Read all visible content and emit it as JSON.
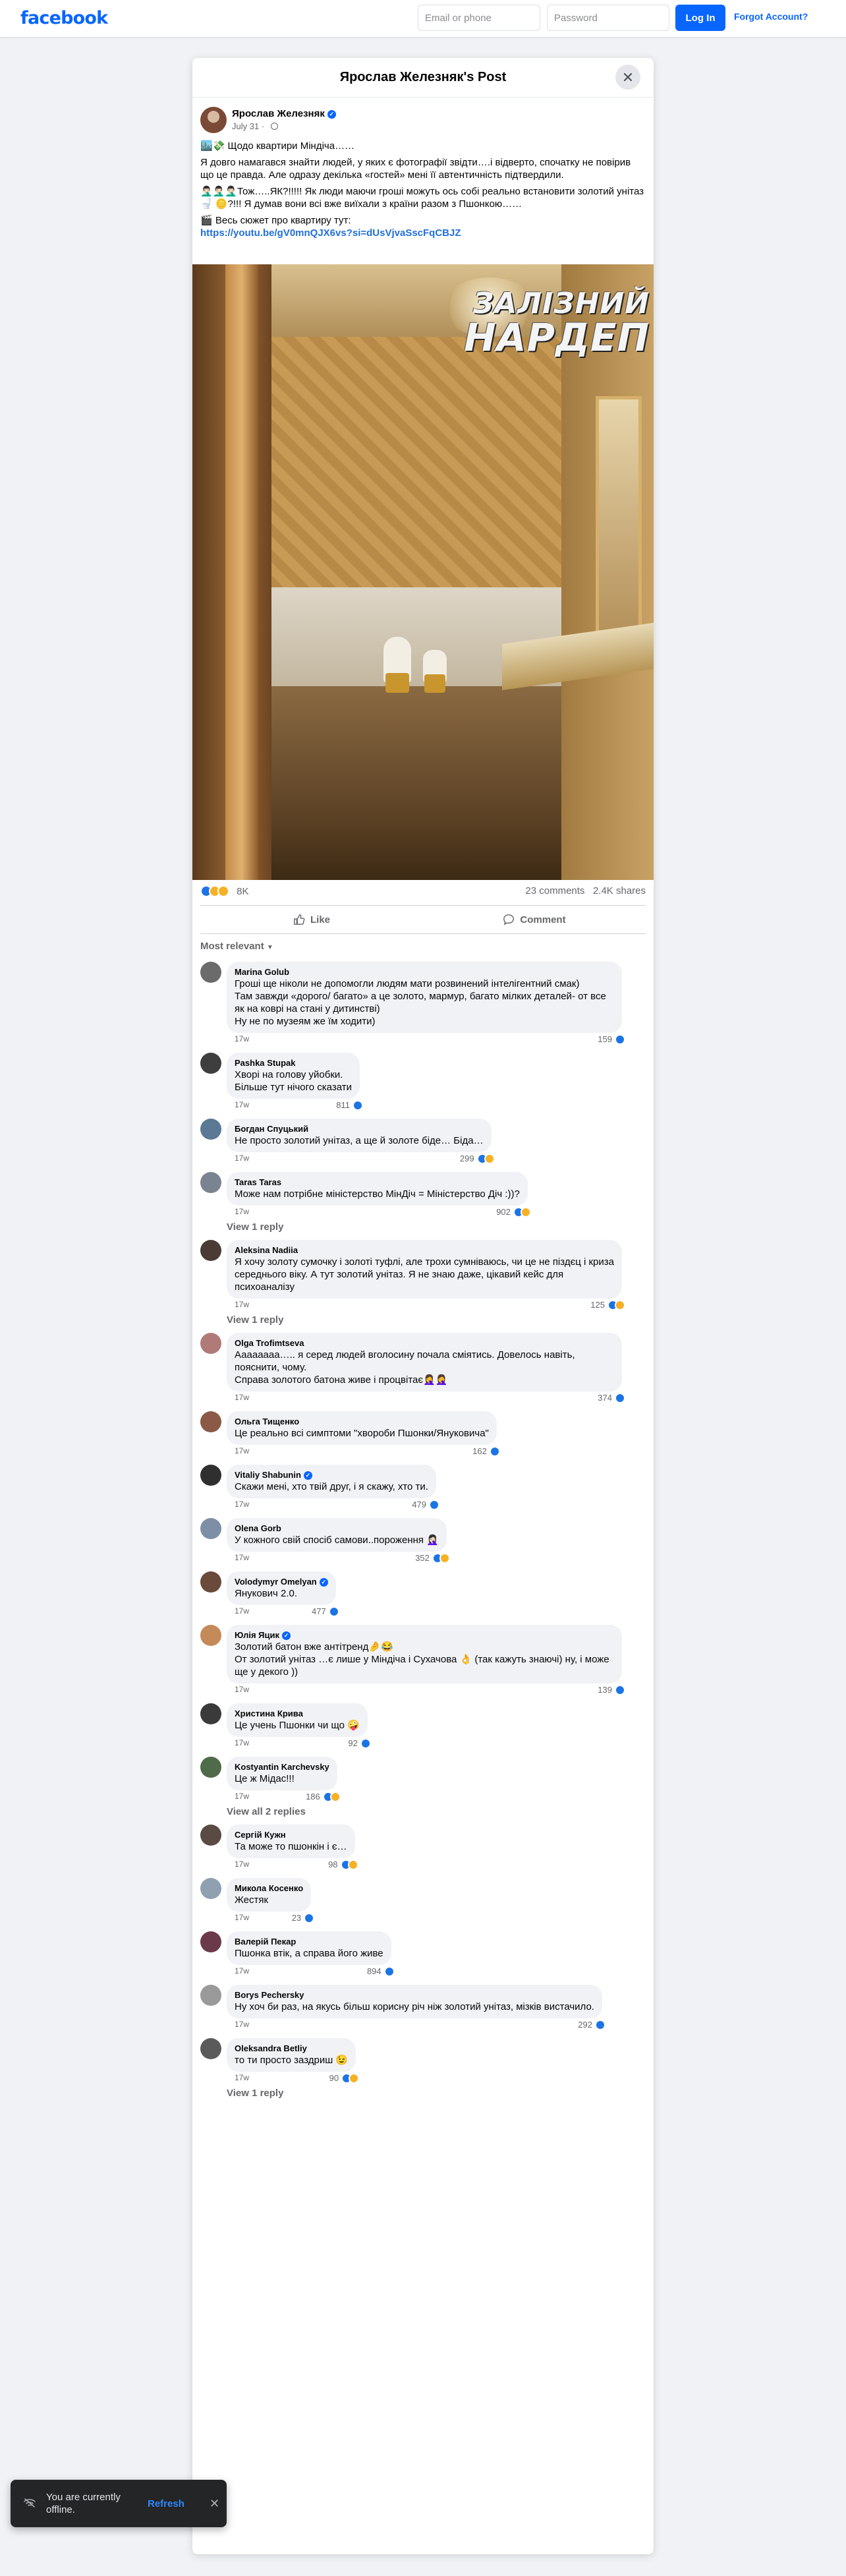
{
  "topbar": {
    "logo": "facebook",
    "email_placeholder": "Email or phone",
    "password_placeholder": "Password",
    "login_label": "Log In",
    "forgot_label": "Forgot Account?"
  },
  "post": {
    "dialog_title": "Ярослав Железняк's Post",
    "author": "Ярослав Железняк",
    "date": "July 31",
    "paragraphs": [
      "🏙️💸 Щодо квартири Міндіча……",
      "Я довго намагався знайти людей, у яких є фотографії звідти….і відверто, спочатку не повірив що це правда. Але одразу декілька «гостей» мені її автентичність підтвердили.",
      "🤦🏻‍♂️🤦🏻‍♂️🤦🏻‍♂️Тож…..ЯК?!!!!! Як люди маючи гроші можуть ось собі реально встановити золотий унітаз 🚽 🪙?!!! Я думав вони всі вже виїхали з країни разом з Пшонкою……",
      "🎬 Весь сюжет про квартиру тут:"
    ],
    "link": "https://youtu.be/gV0mnQJX6vs?si=dUsVjvaSscFqCBJZ",
    "video_logo_line1": "ЗАЛІЗНИЙ",
    "video_logo_line2": "НАРДЕП",
    "reaction_count": "8K",
    "comments_count": "23 comments",
    "shares_count": "2.4K shares",
    "like_label": "Like",
    "comment_label": "Comment",
    "sort_label": "Most relevant"
  },
  "comments": [
    {
      "name": "Marina Golub",
      "verified": false,
      "text": "Гроші ще ніколи не допомогли людям мати розвинений інтелігентний смак)\nТам завжди «дорого/ багато» а це золото, мармур, багато мілких деталей- от все як на коврі на стані у дитинстві)\nНу не по музеям же їм ходити)",
      "time": "17w",
      "reactions": "159",
      "icons": [
        "like"
      ],
      "replies": "",
      "avatar": "#6b6b6b"
    },
    {
      "name": "Pashka Stupak",
      "verified": false,
      "text": "Хворі на голову уйобки.\nБільше тут нічого сказати",
      "time": "17w",
      "reactions": "811",
      "icons": [
        "like"
      ],
      "replies": "",
      "avatar": "#3e3e3e"
    },
    {
      "name": "Богдан Спуцький",
      "verified": false,
      "text": "Не просто золотий унітаз, а ще й золоте біде… Біда…",
      "time": "17w",
      "reactions": "299",
      "icons": [
        "like",
        "haha"
      ],
      "replies": "",
      "avatar": "#5b7894"
    },
    {
      "name": "Taras Taras",
      "verified": false,
      "text": "Може нам потрібне міністерство МінДіч = Міністерство Діч :))?",
      "time": "17w",
      "reactions": "902",
      "icons": [
        "like",
        "haha"
      ],
      "replies": "View 1 reply",
      "avatar": "#7a8490"
    },
    {
      "name": "Aleksina Nadiia",
      "verified": false,
      "text": "Я хочу золоту сумочку і золоті туфлі, але трохи сумніваюсь, чи це не піздєц і криза середнього віку. А тут золотий унітаз. Я не знаю даже, цікавий кейс для психоаналізу",
      "time": "17w",
      "reactions": "125",
      "icons": [
        "like",
        "haha"
      ],
      "replies": "View 1 reply",
      "avatar": "#4a3c34"
    },
    {
      "name": "Olga Trofimtseva",
      "verified": false,
      "text": "Аааааааа….. я серед людей вголосину почала сміятись. Довелось навіть, пояснити, чому.\nСправа золотого батона живе і процвітає🤦‍♀️🤦‍♀️",
      "time": "17w",
      "reactions": "374",
      "icons": [
        "like"
      ],
      "replies": "",
      "avatar": "#b07a78"
    },
    {
      "name": "Ольга Тищенко",
      "verified": false,
      "text": "Це реально всі симптоми \"хвороби Пшонки/Януковича\"",
      "time": "17w",
      "reactions": "162",
      "icons": [
        "like"
      ],
      "replies": "",
      "avatar": "#8a5a46"
    },
    {
      "name": "Vitaliy Shabunin",
      "verified": true,
      "text": "Скажи мені, хто твій друг, і я скажу, хто ти.",
      "time": "17w",
      "reactions": "479",
      "icons": [
        "like"
      ],
      "replies": "",
      "avatar": "#2f2f2f"
    },
    {
      "name": "Olena Gorb",
      "verified": false,
      "text": "У кожного свій спосіб самови..пороження 🤦🏻‍♀️",
      "time": "17w",
      "reactions": "352",
      "icons": [
        "like",
        "haha"
      ],
      "replies": "",
      "avatar": "#7d8fa6"
    },
    {
      "name": "Volodymyr Omelyan",
      "verified": true,
      "text": "Янукович 2.0.",
      "time": "17w",
      "reactions": "477",
      "icons": [
        "like"
      ],
      "replies": "",
      "avatar": "#6a4a3a"
    },
    {
      "name": "Юлія Яцик",
      "verified": true,
      "text": "Золотий батон вже антітренд🤌😂\nОт золотий унітаз …є лише у Міндіча і Сухачова 👌 (так кажуть знаючі) ну, і може ще у декого ))",
      "time": "17w",
      "reactions": "139",
      "icons": [
        "like"
      ],
      "replies": "",
      "avatar": "#c48a5a"
    },
    {
      "name": "Христина Крива",
      "verified": false,
      "text": "Це учень Пшонки чи що 🤪",
      "time": "17w",
      "reactions": "92",
      "icons": [
        "like"
      ],
      "replies": "",
      "avatar": "#3a3a3a"
    },
    {
      "name": "Kostyantin Karchevsky",
      "verified": false,
      "text": "Це ж Мідас!!!",
      "time": "17w",
      "reactions": "186",
      "icons": [
        "like",
        "haha"
      ],
      "replies": "View all 2 replies",
      "avatar": "#4f6b4a"
    },
    {
      "name": "Сергій Кужн",
      "verified": false,
      "text": "Та може то пшонкін і є…",
      "time": "17w",
      "reactions": "98",
      "icons": [
        "like",
        "haha"
      ],
      "replies": "",
      "avatar": "#5a4a44"
    },
    {
      "name": "Микола Косенко",
      "verified": false,
      "text": "Жестяк",
      "time": "17w",
      "reactions": "23",
      "icons": [
        "like"
      ],
      "replies": "",
      "avatar": "#8fa0b0"
    },
    {
      "name": "Валерій Пекар",
      "verified": false,
      "text": "Пшонка втік, а справа його живе",
      "time": "17w",
      "reactions": "894",
      "icons": [
        "like"
      ],
      "replies": "",
      "avatar": "#6b3a4a"
    },
    {
      "name": "Borys Pechersky",
      "verified": false,
      "text": "Ну хоч би раз, на якусь більш корисну річ ніж золотий унітаз, мізків вистачило.",
      "time": "17w",
      "reactions": "292",
      "icons": [
        "like"
      ],
      "replies": "",
      "avatar": "#9a9a9a"
    },
    {
      "name": "Oleksandra Betliy",
      "verified": false,
      "text": "то ти просто заздриш 😉",
      "time": "17w",
      "reactions": "90",
      "icons": [
        "like",
        "haha"
      ],
      "replies": "View 1 reply",
      "avatar": "#5a5a5a"
    }
  ],
  "toast": {
    "message": "You are currently offline.",
    "refresh_label": "Refresh"
  },
  "colors": {
    "brand": "#0866ff",
    "like": "#1b74e4",
    "haha": "#f7b125"
  }
}
